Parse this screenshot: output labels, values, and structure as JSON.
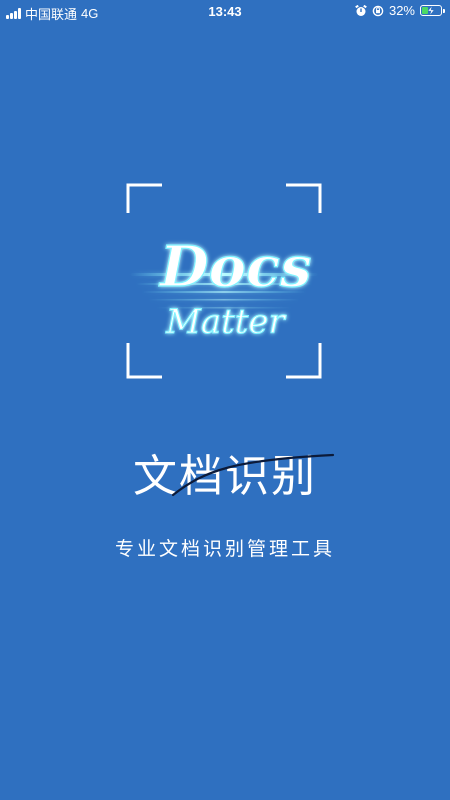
{
  "status_bar": {
    "carrier": "中国联通",
    "network": "4G",
    "time": "13:43",
    "battery_percent": "32%",
    "battery_level": 0.32,
    "battery_color": "#4cd964",
    "icons": [
      "signal-icon",
      "alarm-icon",
      "orientation-lock-icon",
      "battery-icon"
    ]
  },
  "logo": {
    "word_top": "Docs",
    "word_bottom": "Matter",
    "glow_color": "#7ff3ff"
  },
  "splash": {
    "title": "文档识别",
    "subtitle": "专业文档识别管理工具"
  },
  "colors": {
    "background": "#2f70c0",
    "text": "#ffffff"
  }
}
